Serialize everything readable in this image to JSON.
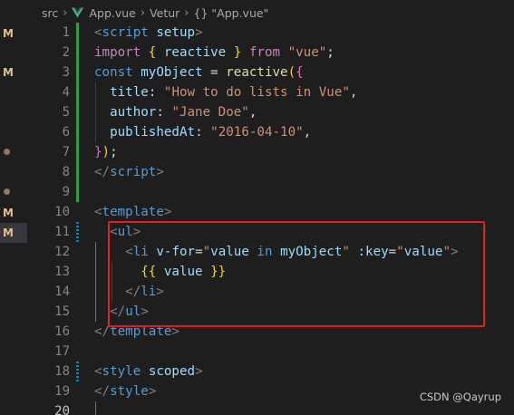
{
  "breadcrumb": {
    "src": "src",
    "file": "App.vue",
    "lang": "Vetur",
    "symbol": "\"App.vue\""
  },
  "explorer_badges": [
    "M",
    "M",
    "M",
    "M"
  ],
  "lines": [
    {
      "n": "1",
      "tokens": [
        {
          "t": "<",
          "c": "t-brk"
        },
        {
          "t": "script",
          "c": "t-tag"
        },
        {
          "t": " ",
          "c": "t-plain"
        },
        {
          "t": "setup",
          "c": "t-attr"
        },
        {
          "t": ">",
          "c": "t-brk"
        }
      ]
    },
    {
      "n": "2",
      "tokens": [
        {
          "t": "import",
          "c": "t-kw"
        },
        {
          "t": " ",
          "c": "t-plain"
        },
        {
          "t": "{",
          "c": "t-b1"
        },
        {
          "t": " reactive ",
          "c": "t-var"
        },
        {
          "t": "}",
          "c": "t-b1"
        },
        {
          "t": " ",
          "c": "t-plain"
        },
        {
          "t": "from",
          "c": "t-kw"
        },
        {
          "t": " ",
          "c": "t-plain"
        },
        {
          "t": "\"vue\"",
          "c": "t-str"
        },
        {
          "t": ";",
          "c": "t-plain"
        }
      ]
    },
    {
      "n": "3",
      "tokens": [
        {
          "t": "const",
          "c": "t-let"
        },
        {
          "t": " ",
          "c": "t-plain"
        },
        {
          "t": "myObject",
          "c": "t-var"
        },
        {
          "t": " = ",
          "c": "t-plain"
        },
        {
          "t": "reactive",
          "c": "t-fn"
        },
        {
          "t": "(",
          "c": "t-b1"
        },
        {
          "t": "{",
          "c": "t-b2"
        }
      ]
    },
    {
      "n": "4",
      "tokens": [
        {
          "t": "  ",
          "c": "t-plain"
        },
        {
          "t": "title",
          "c": "t-prop"
        },
        {
          "t": ": ",
          "c": "t-plain"
        },
        {
          "t": "\"How to do lists in Vue\"",
          "c": "t-str"
        },
        {
          "t": ",",
          "c": "t-plain"
        }
      ]
    },
    {
      "n": "5",
      "tokens": [
        {
          "t": "  ",
          "c": "t-plain"
        },
        {
          "t": "author",
          "c": "t-prop"
        },
        {
          "t": ": ",
          "c": "t-plain"
        },
        {
          "t": "\"Jane Doe\"",
          "c": "t-str"
        },
        {
          "t": ",",
          "c": "t-plain"
        }
      ]
    },
    {
      "n": "6",
      "tokens": [
        {
          "t": "  ",
          "c": "t-plain"
        },
        {
          "t": "publishedAt",
          "c": "t-prop"
        },
        {
          "t": ": ",
          "c": "t-plain"
        },
        {
          "t": "\"2016-04-10\"",
          "c": "t-str"
        },
        {
          "t": ",",
          "c": "t-plain"
        }
      ]
    },
    {
      "n": "7",
      "tokens": [
        {
          "t": "}",
          "c": "t-b2"
        },
        {
          "t": ")",
          "c": "t-b1"
        },
        {
          "t": ";",
          "c": "t-plain"
        }
      ]
    },
    {
      "n": "8",
      "tokens": [
        {
          "t": "</",
          "c": "t-brk"
        },
        {
          "t": "script",
          "c": "t-tag"
        },
        {
          "t": ">",
          "c": "t-brk"
        }
      ]
    },
    {
      "n": "9",
      "tokens": []
    },
    {
      "n": "10",
      "tokens": [
        {
          "t": "<",
          "c": "t-brk"
        },
        {
          "t": "template",
          "c": "t-tag"
        },
        {
          "t": ">",
          "c": "t-brk"
        }
      ]
    },
    {
      "n": "11",
      "tokens": [
        {
          "t": "  ",
          "c": "t-plain"
        },
        {
          "t": "<",
          "c": "t-brk"
        },
        {
          "t": "ul",
          "c": "t-tag"
        },
        {
          "t": ">",
          "c": "t-brk"
        }
      ]
    },
    {
      "n": "12",
      "tokens": [
        {
          "t": "    ",
          "c": "t-plain"
        },
        {
          "t": "<",
          "c": "t-brk"
        },
        {
          "t": "li",
          "c": "t-tag"
        },
        {
          "t": " ",
          "c": "t-plain"
        },
        {
          "t": "v-for",
          "c": "t-attr"
        },
        {
          "t": "=",
          "c": "t-plain"
        },
        {
          "t": "\"",
          "c": "t-str"
        },
        {
          "t": "value",
          "c": "t-var"
        },
        {
          "t": " in ",
          "c": "t-let"
        },
        {
          "t": "myObject",
          "c": "t-var"
        },
        {
          "t": "\"",
          "c": "t-str"
        },
        {
          "t": " ",
          "c": "t-plain"
        },
        {
          "t": ":key",
          "c": "t-attr"
        },
        {
          "t": "=",
          "c": "t-plain"
        },
        {
          "t": "\"",
          "c": "t-str"
        },
        {
          "t": "value",
          "c": "t-var"
        },
        {
          "t": "\"",
          "c": "t-str"
        },
        {
          "t": ">",
          "c": "t-brk"
        }
      ]
    },
    {
      "n": "13",
      "tokens": [
        {
          "t": "      ",
          "c": "t-plain"
        },
        {
          "t": "{{",
          "c": "t-b1"
        },
        {
          "t": " value ",
          "c": "t-var"
        },
        {
          "t": "}}",
          "c": "t-b1"
        }
      ]
    },
    {
      "n": "14",
      "tokens": [
        {
          "t": "    ",
          "c": "t-plain"
        },
        {
          "t": "</",
          "c": "t-brk"
        },
        {
          "t": "li",
          "c": "t-tag"
        },
        {
          "t": ">",
          "c": "t-brk"
        }
      ]
    },
    {
      "n": "15",
      "tokens": [
        {
          "t": "  ",
          "c": "t-plain"
        },
        {
          "t": "</",
          "c": "t-brk"
        },
        {
          "t": "ul",
          "c": "t-tag"
        },
        {
          "t": ">",
          "c": "t-brk"
        }
      ]
    },
    {
      "n": "16",
      "tokens": [
        {
          "t": "</",
          "c": "t-brk"
        },
        {
          "t": "template",
          "c": "t-tag"
        },
        {
          "t": ">",
          "c": "t-brk"
        }
      ]
    },
    {
      "n": "17",
      "tokens": []
    },
    {
      "n": "18",
      "tokens": [
        {
          "t": "<",
          "c": "t-brk"
        },
        {
          "t": "style",
          "c": "t-tag"
        },
        {
          "t": " ",
          "c": "t-plain"
        },
        {
          "t": "scoped",
          "c": "t-attr"
        },
        {
          "t": ">",
          "c": "t-brk"
        }
      ]
    },
    {
      "n": "19",
      "tokens": [
        {
          "t": "</",
          "c": "t-brk"
        },
        {
          "t": "style",
          "c": "t-tag"
        },
        {
          "t": ">",
          "c": "t-brk"
        }
      ]
    },
    {
      "n": "20",
      "tokens": []
    }
  ],
  "current_line": "20",
  "watermark": "CSDN @Qayrup",
  "colors": {
    "background": "#1e1e1e",
    "git_added": "#2ea043",
    "git_modified": "#1b81a8",
    "highlight_box": "#e51c23",
    "modified_badge": "#e2c08d"
  }
}
